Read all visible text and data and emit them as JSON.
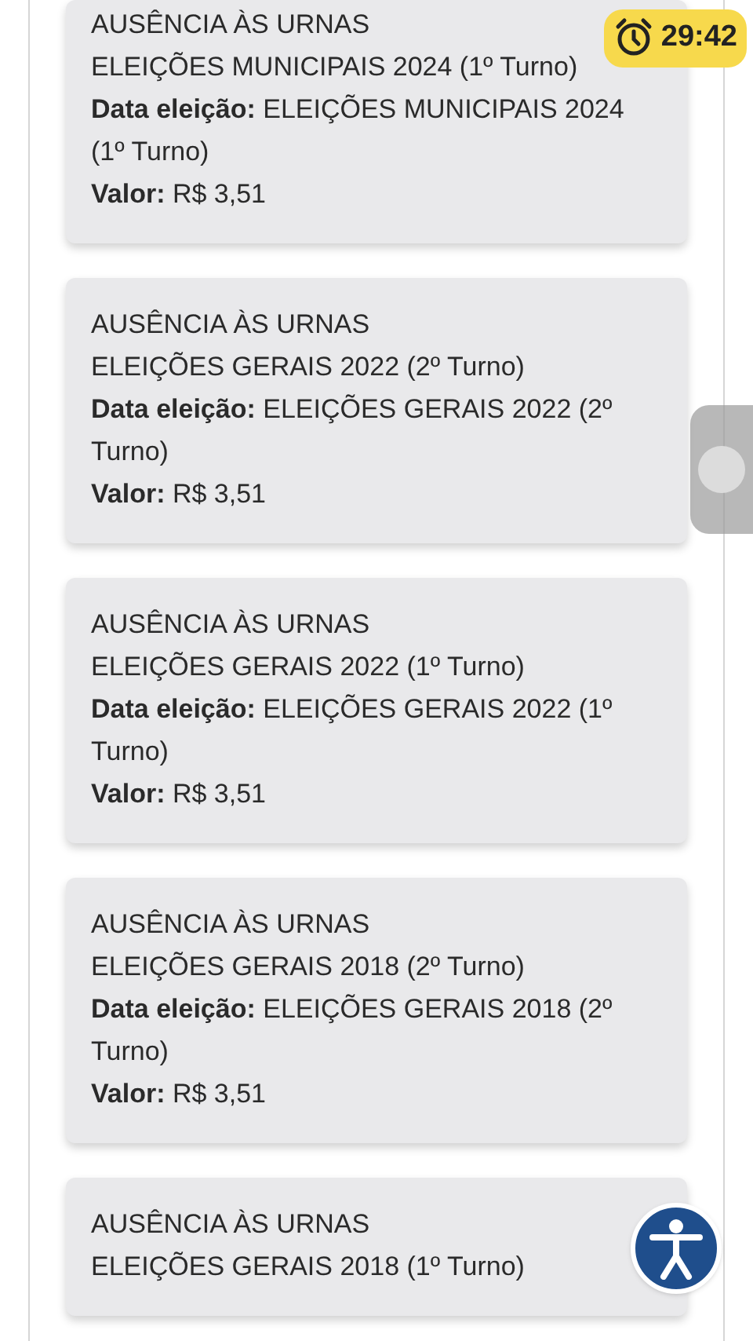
{
  "timer": {
    "time": "29:42"
  },
  "cards": [
    {
      "title": "AUSÊNCIA ÀS URNAS",
      "election": "ELEIÇÕES MUNICIPAIS 2024 (1º Turno)",
      "date_label": "Data eleição:",
      "date_value": "ELEIÇÕES MUNICIPAIS 2024 (1º Turno)",
      "value_label": "Valor:",
      "value": "R$ 3,51"
    },
    {
      "title": "AUSÊNCIA ÀS URNAS",
      "election": "ELEIÇÕES GERAIS 2022 (2º Turno)",
      "date_label": "Data eleição:",
      "date_value": "ELEIÇÕES GERAIS 2022 (2º Turno)",
      "value_label": "Valor:",
      "value": "R$ 3,51"
    },
    {
      "title": "AUSÊNCIA ÀS URNAS",
      "election": "ELEIÇÕES GERAIS 2022 (1º Turno)",
      "date_label": "Data eleição:",
      "date_value": "ELEIÇÕES GERAIS 2022 (1º Turno)",
      "value_label": "Valor:",
      "value": "R$ 3,51"
    },
    {
      "title": "AUSÊNCIA ÀS URNAS",
      "election": "ELEIÇÕES GERAIS 2018 (2º Turno)",
      "date_label": "Data eleição:",
      "date_value": "ELEIÇÕES GERAIS 2018 (2º Turno)",
      "value_label": "Valor:",
      "value": "R$ 3,51"
    },
    {
      "title": "AUSÊNCIA ÀS URNAS",
      "election": "ELEIÇÕES GERAIS 2018 (1º Turno)"
    }
  ]
}
